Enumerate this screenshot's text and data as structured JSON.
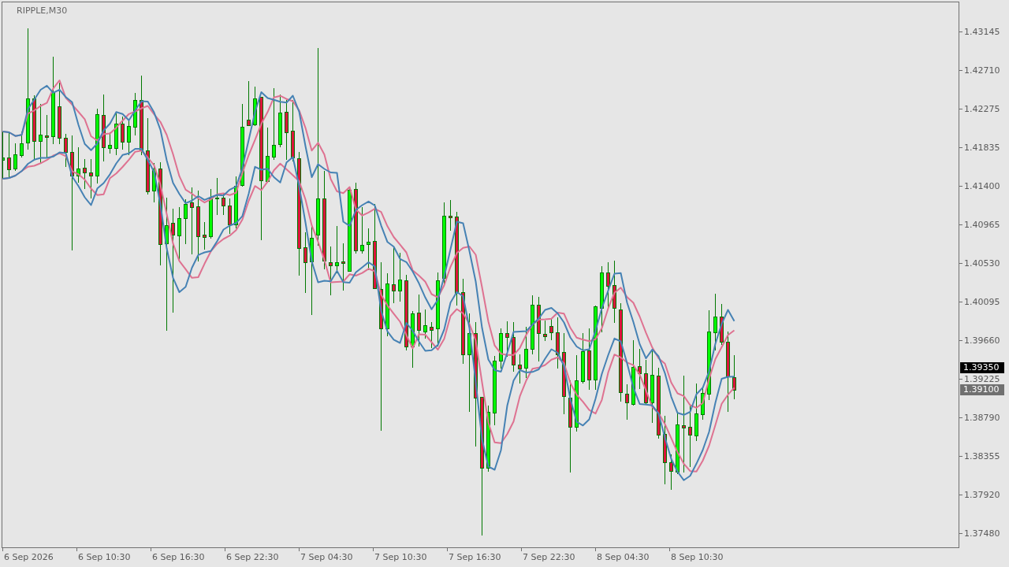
{
  "chart": {
    "title": "RIPPLE,M30"
  },
  "price_axis": {
    "labels": [
      "1.43145",
      "1.42710",
      "1.42275",
      "1.41835",
      "1.41400",
      "1.40965",
      "1.40530",
      "1.40095",
      "1.39660",
      "1.39225",
      "1.38790",
      "1.38355",
      "1.37920",
      "1.37480"
    ]
  },
  "time_axis": {
    "labels": [
      "6 Sep 2026",
      "6 Sep 10:30",
      "6 Sep 16:30",
      "6 Sep 22:30",
      "7 Sep 04:30",
      "7 Sep 10:30",
      "7 Sep 16:30",
      "7 Sep 22:30",
      "8 Sep 04:30",
      "8 Sep 10:30"
    ]
  },
  "price_tags": [
    {
      "text": "1.39350",
      "color": "#000000"
    },
    {
      "text": "1.39100",
      "color": "#707070"
    }
  ]
}
